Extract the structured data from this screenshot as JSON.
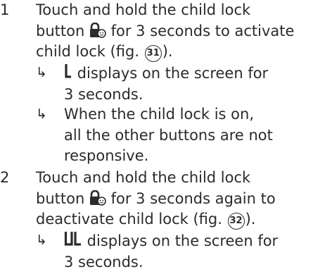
{
  "steps": [
    {
      "number": "1",
      "lines": {
        "l1": "Touch and hold the child lock",
        "l2_before_icon": "button ",
        "l2_after_icon": " for 3 seconds to activate",
        "l3_before_ref": "child lock (fig. ",
        "l3_ref": "31",
        "l3_after_ref": ")."
      },
      "icon": "child-lock-icon",
      "subpoints": [
        {
          "arrow": "↳",
          "display_glyph": "L",
          "l1_after_glyph": " displays on the screen for",
          "l2": "3 seconds."
        },
        {
          "arrow": "↳",
          "l1": "When the child lock is on,",
          "l2": "all the other buttons are not",
          "l3": "responsive."
        }
      ]
    },
    {
      "number": "2",
      "lines": {
        "l1": "Touch and hold the child lock",
        "l2_before_icon": "button ",
        "l2_after_icon": " for 3 seconds again to",
        "l3_before_ref": "deactivate child lock (fig. ",
        "l3_ref": "32",
        "l3_after_ref": ")."
      },
      "icon": "child-lock-icon",
      "subpoints": [
        {
          "arrow": "↳",
          "display_glyph": "UL",
          "l1_after_glyph": " displays on the screen for",
          "l2": "3 seconds."
        }
      ]
    }
  ]
}
